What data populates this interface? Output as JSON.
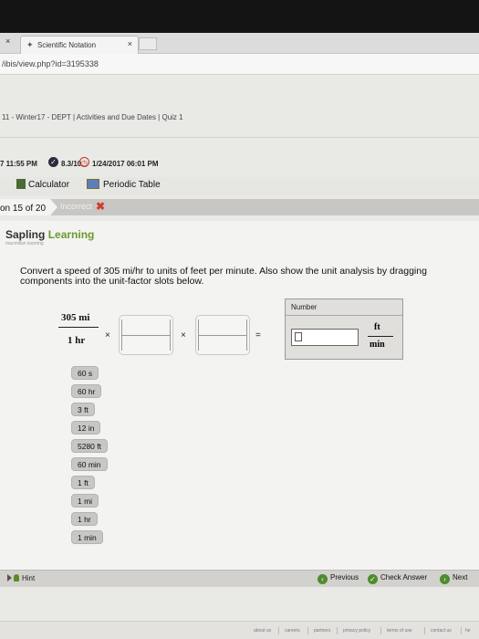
{
  "browser": {
    "tab_title": "Scientific Notation",
    "tab_close": "×",
    "left_close": "×",
    "address": "/ibis/view.php?id=3195338"
  },
  "breadcrumb": "11 - Winter17 - DEPT   |   Activities and Due Dates   |   Quiz 1",
  "info": {
    "time": "7 11:55 PM",
    "score": "8.3/10",
    "due": "1/24/2017 06:01 PM"
  },
  "tools": {
    "calculator": "Calculator",
    "periodic_table": "Periodic Table"
  },
  "question_bar": {
    "progress": "on 15 of 20",
    "status": "Incorrect",
    "status_mark": "✖"
  },
  "brand": {
    "name": "Sapling",
    "name2": "Learning",
    "sub": "macmillan learning"
  },
  "question": "Convert a speed of 305 mi/hr to units of feet per minute. Also show the unit analysis by dragging components into the unit-factor slots below.",
  "equation": {
    "given_num": "305  mi",
    "given_den": "1  hr",
    "times": "×",
    "equals": "=",
    "answer_label": "Number",
    "answer_value": "",
    "unit_num": "ft",
    "unit_den": "min"
  },
  "chips": [
    "60 s",
    "60 hr",
    "3 ft",
    "12 in",
    "5280 ft",
    "60 min",
    "1 ft",
    "1 mi",
    "1 hr",
    "1 min"
  ],
  "footer": {
    "hint": "Hint",
    "previous": "Previous",
    "check": "Check Answer",
    "next": "Next"
  },
  "links": [
    "about us",
    "careers",
    "partners",
    "privacy policy",
    "terms of use",
    "contact us",
    "he"
  ]
}
